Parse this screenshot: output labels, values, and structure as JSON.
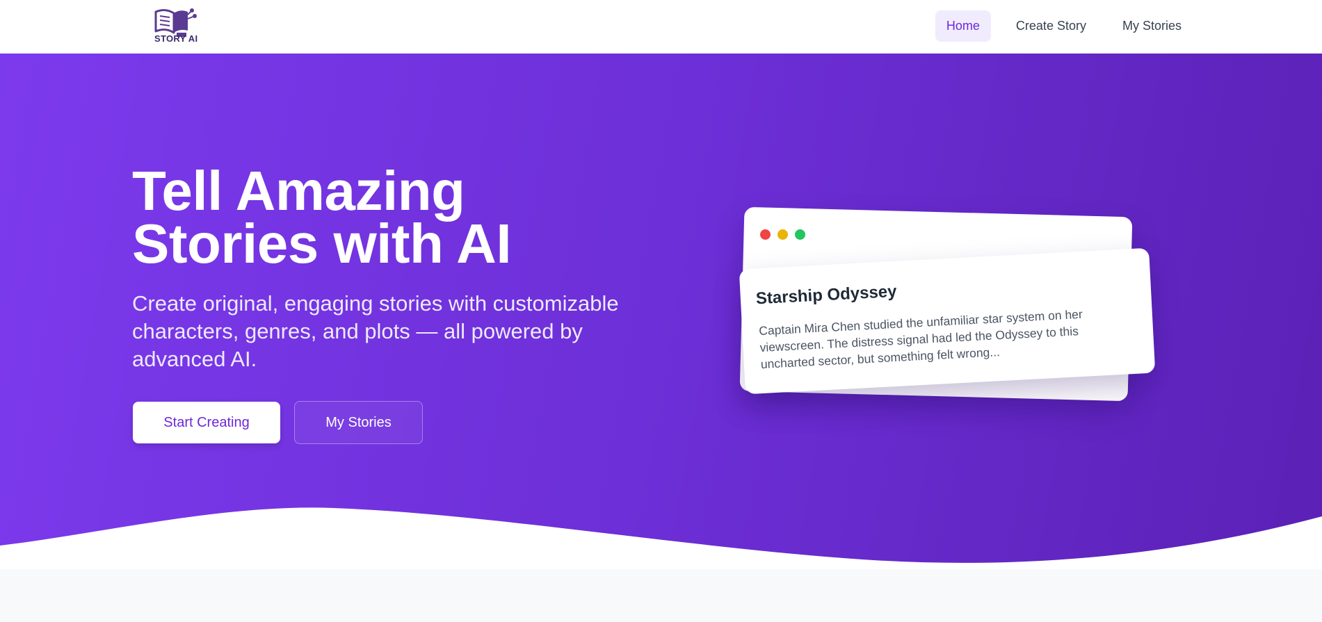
{
  "logo": {
    "text": "STORY AI",
    "icon": "book-robot-icon"
  },
  "nav": {
    "items": [
      {
        "label": "Home",
        "active": true
      },
      {
        "label": "Create Story",
        "active": false
      },
      {
        "label": "My Stories",
        "active": false
      }
    ]
  },
  "hero": {
    "title": "Tell Amazing Stories with AI",
    "subtitle": "Create original, engaging stories with customizable characters, genres, and plots — all powered by advanced AI.",
    "primary_button": "Start Creating",
    "secondary_button": "My Stories"
  },
  "preview_card": {
    "title": "Starship Odyssey",
    "text": "Captain Mira Chen studied the unfamiliar star system on her viewscreen. The distress signal had led the Odyssey to this uncharted sector, but something felt wrong..."
  },
  "colors": {
    "accent": "#6d28d9",
    "hero_gradient_start": "#7c3aed",
    "hero_gradient_end": "#5b21b6",
    "nav_active_bg": "#f0ecfe"
  }
}
